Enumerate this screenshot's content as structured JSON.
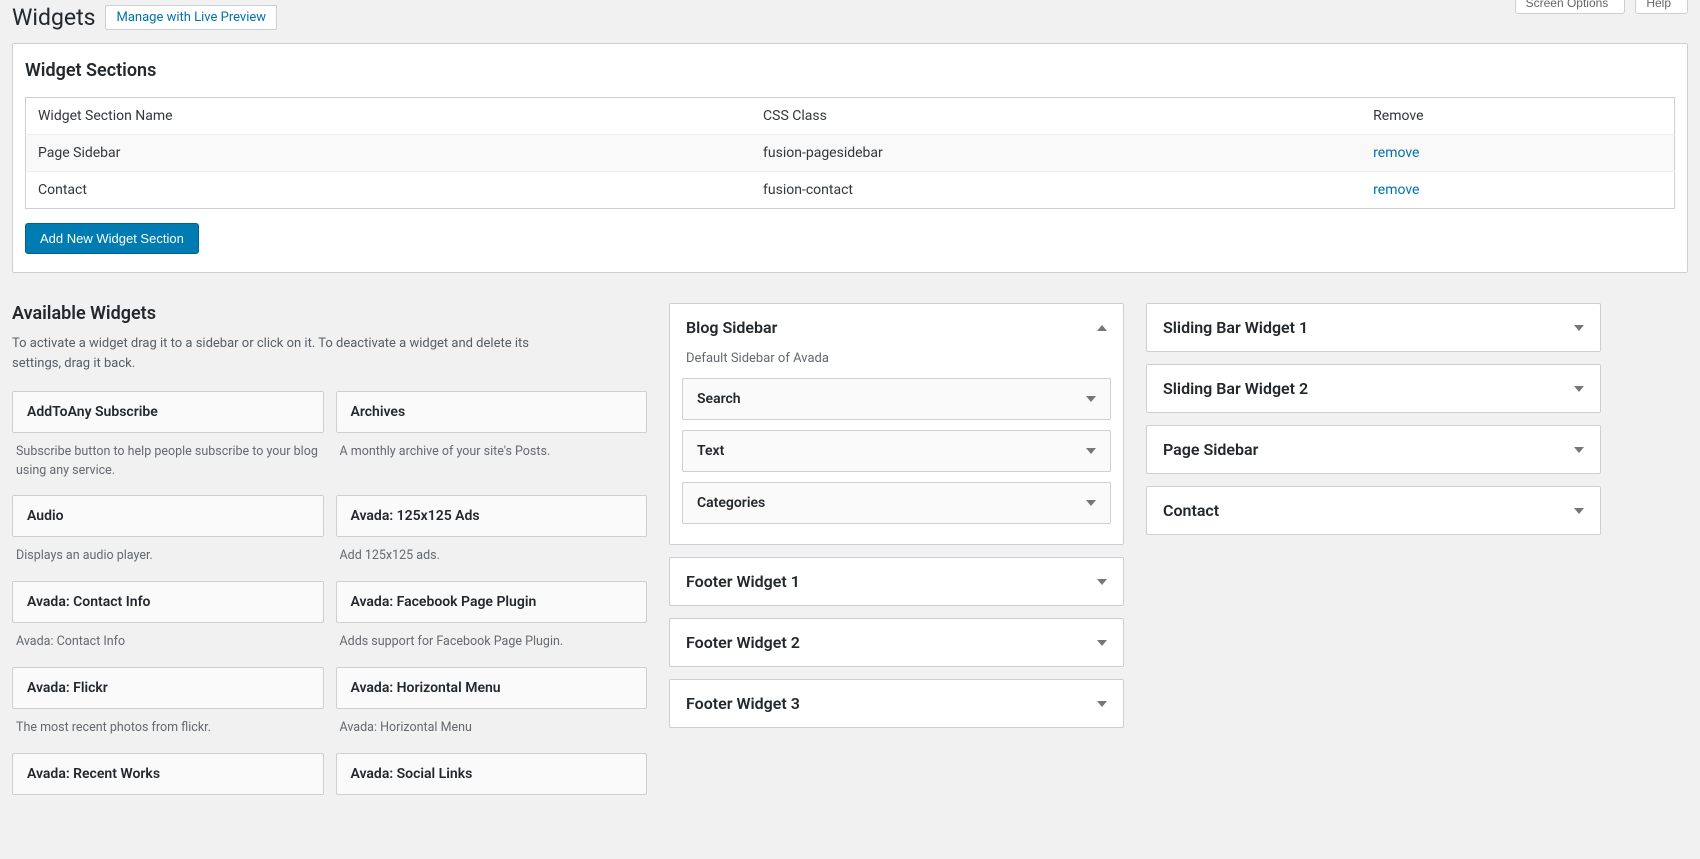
{
  "page": {
    "title": "Widgets",
    "manage_link": "Manage with Live Preview",
    "screen_options": "Screen Options",
    "help": "Help"
  },
  "sections_panel": {
    "heading": "Widget Sections",
    "columns": {
      "name": "Widget Section Name",
      "css": "CSS Class",
      "remove": "Remove"
    },
    "rows": [
      {
        "name": "Page Sidebar",
        "css": "fusion-pagesidebar",
        "remove": "remove"
      },
      {
        "name": "Contact",
        "css": "fusion-contact",
        "remove": "remove"
      }
    ],
    "add_button": "Add New Widget Section"
  },
  "available": {
    "heading": "Available Widgets",
    "description": "To activate a widget drag it to a sidebar or click on it. To deactivate a widget and delete its settings, drag it back.",
    "widgets": [
      {
        "name": "AddToAny Subscribe",
        "desc": "Subscribe button to help people subscribe to your blog using any service."
      },
      {
        "name": "Archives",
        "desc": "A monthly archive of your site's Posts."
      },
      {
        "name": "Audio",
        "desc": "Displays an audio player."
      },
      {
        "name": "Avada: 125x125 Ads",
        "desc": "Add 125x125 ads."
      },
      {
        "name": "Avada: Contact Info",
        "desc": "Avada: Contact Info"
      },
      {
        "name": "Avada: Facebook Page Plugin",
        "desc": "Adds support for Facebook Page Plugin."
      },
      {
        "name": "Avada: Flickr",
        "desc": "The most recent photos from flickr."
      },
      {
        "name": "Avada: Horizontal Menu",
        "desc": "Avada: Horizontal Menu"
      },
      {
        "name": "Avada: Recent Works",
        "desc": ""
      },
      {
        "name": "Avada: Social Links",
        "desc": ""
      }
    ]
  },
  "sidebars_mid": [
    {
      "title": "Blog Sidebar",
      "description": "Default Sidebar of Avada",
      "expanded": true,
      "widgets": [
        "Search",
        "Text",
        "Categories"
      ]
    },
    {
      "title": "Footer Widget 1",
      "expanded": false
    },
    {
      "title": "Footer Widget 2",
      "expanded": false
    },
    {
      "title": "Footer Widget 3",
      "expanded": false
    }
  ],
  "sidebars_right": [
    {
      "title": "Sliding Bar Widget 1",
      "expanded": false
    },
    {
      "title": "Sliding Bar Widget 2",
      "expanded": false
    },
    {
      "title": "Page Sidebar",
      "expanded": false
    },
    {
      "title": "Contact",
      "expanded": false
    }
  ]
}
